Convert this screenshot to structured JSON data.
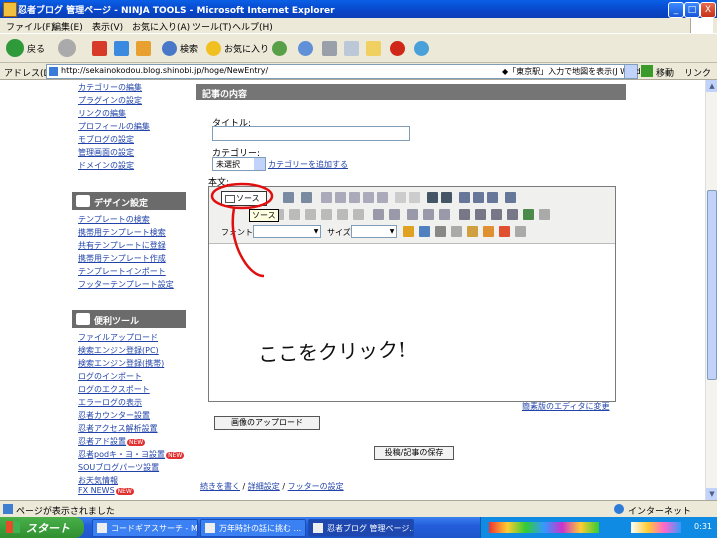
{
  "window": {
    "title": "忍者ブログ 管理ページ - NINJA TOOLS - Microsoft Internet Explorer",
    "controls": [
      "_",
      "□",
      "X"
    ]
  },
  "menu": {
    "items": [
      "ファイル(F)",
      "編集(E)",
      "表示(V)",
      "お気に入り(A)",
      "ツール(T)",
      "ヘルプ(H)"
    ]
  },
  "toolbar": {
    "back_label": "戻る",
    "search_label": "検索",
    "favorites_label": "お気に入り"
  },
  "address": {
    "label": "アドレス(D)",
    "url": "http://sekainokodou.blog.shinobi.jp/hoge/NewEntry/",
    "map_hint": "◆「東京駅」入力で地図を表示(J Word)",
    "go_label": "移動",
    "links_label": "リンク »"
  },
  "sidebar": {
    "top_links": [
      "カテゴリーの編集",
      "プラグインの設定",
      "リンクの編集",
      "プロフィールの編集",
      "モブログの設定",
      "管理画面の設定",
      "ドメインの設定"
    ],
    "design_heading": "デザイン設定",
    "design_links": [
      "テンプレートの検索",
      "携帯用テンプレート検索",
      "共有テンプレートに登録",
      "携帯用テンプレート作成",
      "テンプレートインポート",
      "フッターテンプレート設定"
    ],
    "tools_heading": "便利ツール",
    "tools_links": [
      "ファイルアップロード",
      "検索エンジン登録(PC)",
      "検索エンジン登録(携帯)",
      "ログのインポート",
      "ログのエクスポート",
      "エラーログの表示",
      "忍者カウンター設置",
      "忍者アクセス解析設置",
      "忍者アド設置",
      "忍者podキ・ヨ・ヨ設置",
      "SOUブログパーツ設置",
      "お天気情報",
      "FX NEWS"
    ],
    "new_badge": "NEW"
  },
  "main": {
    "section_title": "記事の内容",
    "title_label": "タイトル:",
    "title_value": "",
    "category_label": "カテゴリー:",
    "category_value": "未選択",
    "add_category_link": "カテゴリーを追加する",
    "body_label": "本文:",
    "source_button": "ソース",
    "tooltip": "ソース",
    "font_label": "フォント",
    "size_label": "サイズ",
    "rich_editor_link": "簡素版のエディタに変更",
    "upload_button": "画像のアップロード",
    "save_button": "投稿/記事の保存",
    "bottom_link_1": "続きを書く",
    "bottom_sep": "/",
    "bottom_link_2": "詳細設定",
    "bottom_link_3": "フッターの設定"
  },
  "annotation": {
    "text": "ここをクリック!",
    "color": "#e01010"
  },
  "status": {
    "text": "ページが表示されました",
    "zone": "インターネット"
  },
  "taskbar": {
    "start_label": "スタート",
    "tasks": [
      "コードギアスサーチ - Mi...",
      "万年時計の話に挑む ...",
      "忍者ブログ 管理ページ..."
    ],
    "clock": "0:31"
  }
}
